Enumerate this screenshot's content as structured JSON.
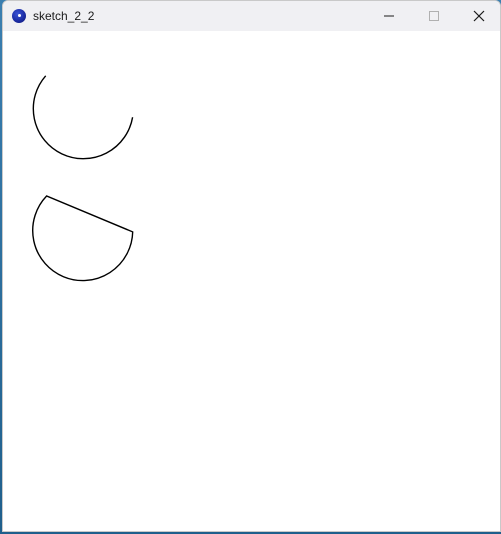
{
  "window": {
    "title": "sketch_2_2",
    "app_icon": "processing-app-icon",
    "controls": [
      "minimize-icon",
      "maximize-icon",
      "close-icon"
    ]
  },
  "canvas": {
    "background": "#ffffff",
    "stroke": "#000000",
    "shapes": [
      "open-arc",
      "chord-arc"
    ]
  }
}
